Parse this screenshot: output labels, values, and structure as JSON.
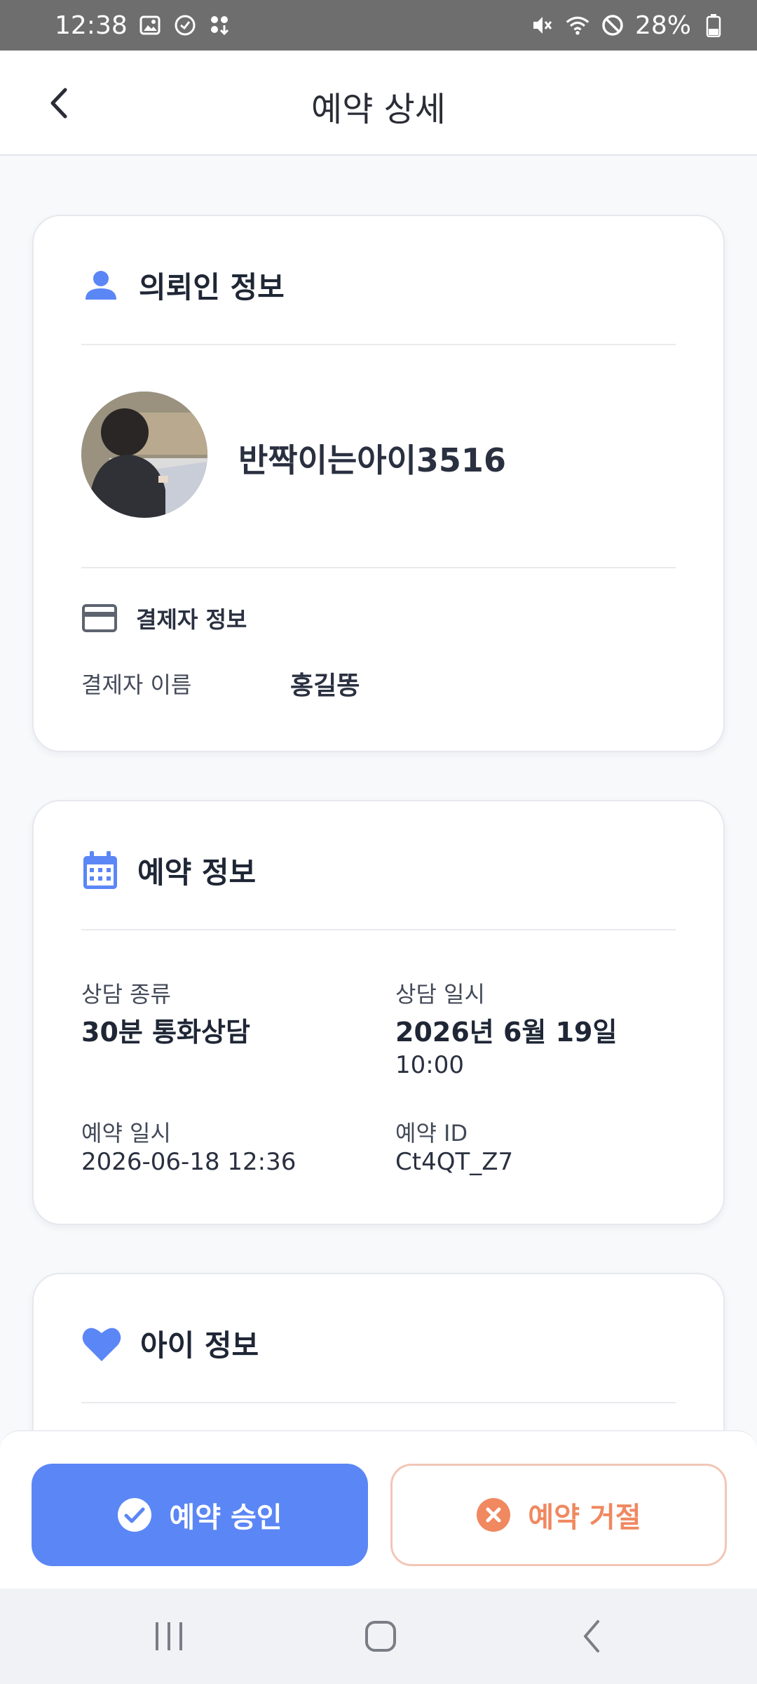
{
  "status_bar": {
    "time": "12:38",
    "battery": "28%",
    "icons": [
      "gallery-icon",
      "messenger-icon",
      "dots-download-icon",
      "mute-icon",
      "wifi-icon",
      "do-not-disturb-icon",
      "battery-icon"
    ]
  },
  "header": {
    "title": "예약 상세",
    "back_icon": "chevron-left-icon"
  },
  "client_card": {
    "title": "의뢰인 정보",
    "icon": "person-icon",
    "nickname": "반짝이는아이3516",
    "payment": {
      "title": "결제자 정보",
      "icon": "credit-card-icon",
      "payer_label": "결제자 이름",
      "payer_name": "홍길똥"
    }
  },
  "reservation_card": {
    "title": "예약 정보",
    "icon": "calendar-icon",
    "consult_type_label": "상담 종류",
    "consult_type": "30분 통화상담",
    "consult_date_label": "상담 일시",
    "consult_date": "2026년 6월 19일",
    "consult_time": "10:00",
    "reserved_at_label": "예약 일시",
    "reserved_at": "2026-06-18 12:36",
    "reservation_id_label": "예약 ID",
    "reservation_id": "Ct4QT_Z7"
  },
  "child_card": {
    "title": "아이 정보",
    "icon": "heart-icon"
  },
  "actions": {
    "approve_label": "예약 승인",
    "reject_label": "예약 거절",
    "approve_color": "#5b86f6",
    "reject_color": "#f08860"
  },
  "colors": {
    "accent": "#5b86f6",
    "reject": "#f08860"
  }
}
